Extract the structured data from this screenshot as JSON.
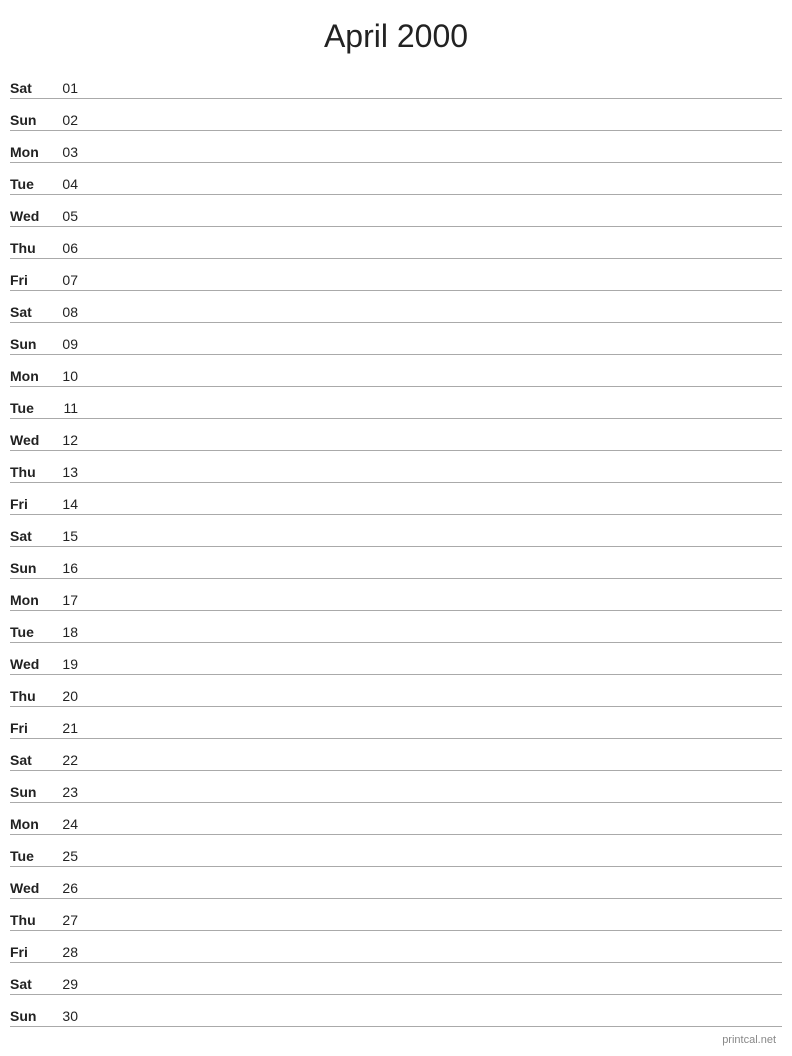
{
  "header": {
    "title": "April 2000"
  },
  "days": [
    {
      "name": "Sat",
      "number": "01"
    },
    {
      "name": "Sun",
      "number": "02"
    },
    {
      "name": "Mon",
      "number": "03"
    },
    {
      "name": "Tue",
      "number": "04"
    },
    {
      "name": "Wed",
      "number": "05"
    },
    {
      "name": "Thu",
      "number": "06"
    },
    {
      "name": "Fri",
      "number": "07"
    },
    {
      "name": "Sat",
      "number": "08"
    },
    {
      "name": "Sun",
      "number": "09"
    },
    {
      "name": "Mon",
      "number": "10"
    },
    {
      "name": "Tue",
      "number": "11"
    },
    {
      "name": "Wed",
      "number": "12"
    },
    {
      "name": "Thu",
      "number": "13"
    },
    {
      "name": "Fri",
      "number": "14"
    },
    {
      "name": "Sat",
      "number": "15"
    },
    {
      "name": "Sun",
      "number": "16"
    },
    {
      "name": "Mon",
      "number": "17"
    },
    {
      "name": "Tue",
      "number": "18"
    },
    {
      "name": "Wed",
      "number": "19"
    },
    {
      "name": "Thu",
      "number": "20"
    },
    {
      "name": "Fri",
      "number": "21"
    },
    {
      "name": "Sat",
      "number": "22"
    },
    {
      "name": "Sun",
      "number": "23"
    },
    {
      "name": "Mon",
      "number": "24"
    },
    {
      "name": "Tue",
      "number": "25"
    },
    {
      "name": "Wed",
      "number": "26"
    },
    {
      "name": "Thu",
      "number": "27"
    },
    {
      "name": "Fri",
      "number": "28"
    },
    {
      "name": "Sat",
      "number": "29"
    },
    {
      "name": "Sun",
      "number": "30"
    }
  ],
  "footer": {
    "text": "printcal.net"
  }
}
